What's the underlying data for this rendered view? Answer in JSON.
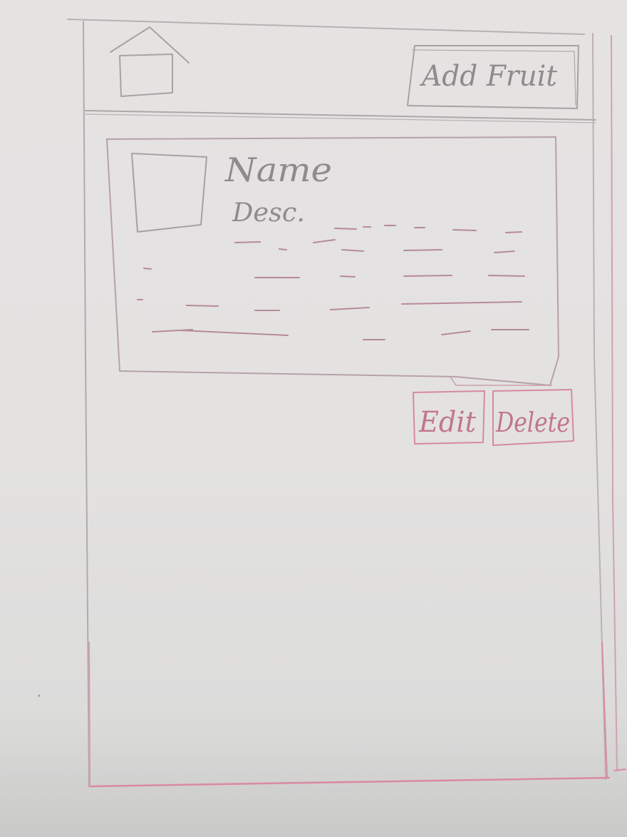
{
  "header": {
    "home_icon": "home-icon",
    "add_button_label": "Add Fruit"
  },
  "fruit_card": {
    "image_icon": "image-placeholder-icon",
    "name": "Name",
    "description": "Desc."
  },
  "actions": {
    "edit_label": "Edit",
    "delete_label": "Delete"
  },
  "colors": {
    "pencil": "#a8a6a7",
    "pink_ink": "#d1849a",
    "paper": "#e4e2e1"
  }
}
